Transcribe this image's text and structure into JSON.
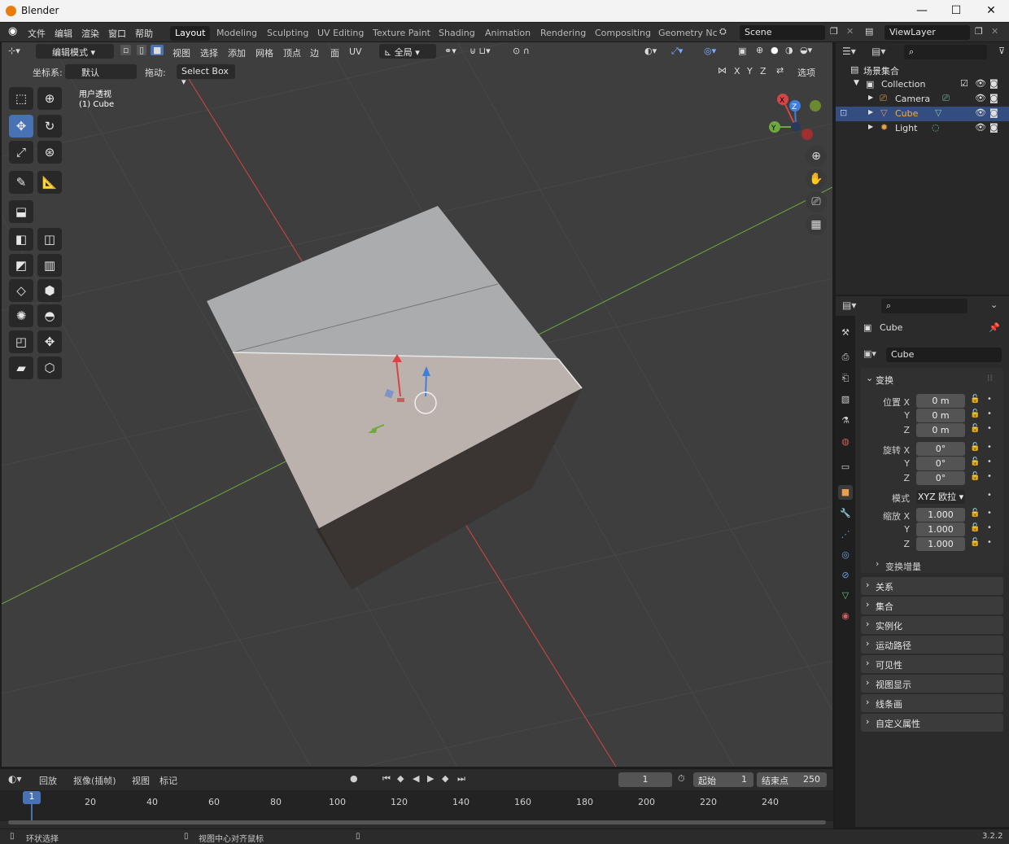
{
  "window": {
    "title": "Blender",
    "minimize": "—",
    "maximize": "☐",
    "close": "✕"
  },
  "topmenu": [
    "文件",
    "编辑",
    "渲染",
    "窗口",
    "帮助"
  ],
  "workspaces": [
    "Layout",
    "Modeling",
    "Sculpting",
    "UV Editing",
    "Texture Paint",
    "Shading",
    "Animation",
    "Rendering",
    "Compositing",
    "Geometry Nc"
  ],
  "active_workspace": "Layout",
  "scene": "Scene",
  "view_layer": "ViewLayer",
  "viewport_header": {
    "mode": "编辑模式",
    "menus": [
      "视图",
      "选择",
      "添加",
      "网格",
      "顶点",
      "边",
      "面",
      "UV"
    ],
    "transform_orientation": "全局",
    "coord_label": "坐标系:",
    "coord_value": "默认",
    "drag_label": "拖动:",
    "drag_value": "Select Box",
    "axes": [
      "X",
      "Y",
      "Z"
    ],
    "options": "选项"
  },
  "viewport": {
    "view_name": "用户透视",
    "object_name": "(1) Cube"
  },
  "gizmo": {
    "x": "X",
    "y": "Y",
    "z": "Z"
  },
  "outliner": {
    "root": "场景集合",
    "items": [
      {
        "name": "Collection"
      },
      {
        "name": "Camera"
      },
      {
        "name": "Cube"
      },
      {
        "name": "Light"
      }
    ]
  },
  "properties": {
    "object_name": "Cube",
    "data_name": "Cube",
    "transform_title": "变换",
    "location_label": "位置 X",
    "rotation_label": "旋转 X",
    "scale_label": "缩放 X",
    "y_label": "Y",
    "z_label": "Z",
    "location": [
      "0 m",
      "0 m",
      "0 m"
    ],
    "rotation": [
      "0°",
      "0°",
      "0°"
    ],
    "mode_label": "模式",
    "mode_value": "XYZ 欧拉",
    "scale": [
      "1.000",
      "1.000",
      "1.000"
    ],
    "delta": "变换增量",
    "panels": [
      "关系",
      "集合",
      "实例化",
      "运动路径",
      "可见性",
      "视图显示",
      "线条画",
      "自定义属性"
    ]
  },
  "timeline": {
    "menus": [
      "回放",
      "抠像(插帧)",
      "视图",
      "标记"
    ],
    "current_frame": "1",
    "start_label": "起始",
    "start": "1",
    "end_label": "结束点",
    "end": "250",
    "ticks": [
      "20",
      "40",
      "60",
      "80",
      "100",
      "120",
      "140",
      "160",
      "180",
      "200",
      "220",
      "240"
    ],
    "marker": "1"
  },
  "status": {
    "left": "环状选择",
    "middle": "视图中心对齐鼠标",
    "version": "3.2.2"
  },
  "colors": {
    "accent": "#4772b3",
    "selected_text": "#ffaf29",
    "x_axis": "#d64545",
    "y_axis": "#6fa83c",
    "z_axis": "#3f7fd9"
  }
}
